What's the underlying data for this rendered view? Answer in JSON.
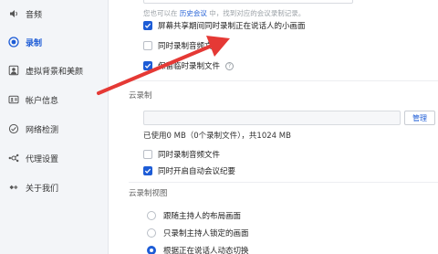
{
  "sidebar": {
    "items": [
      {
        "label": "音频",
        "icon": "speaker-icon",
        "active": false
      },
      {
        "label": "录制",
        "icon": "record-icon",
        "active": true
      },
      {
        "label": "虚拟背景和美颜",
        "icon": "portrait-icon",
        "active": false
      },
      {
        "label": "帐户信息",
        "icon": "account-icon",
        "active": false
      },
      {
        "label": "网络检测",
        "icon": "network-icon",
        "active": false
      },
      {
        "label": "代理设置",
        "icon": "proxy-icon",
        "active": false
      },
      {
        "label": "关于我们",
        "icon": "info-icon",
        "active": false
      }
    ]
  },
  "local_recording": {
    "hint_prefix": "您也可以在",
    "hint_link": "历史会议",
    "hint_suffix": "中，找到对应的会议录制记录。",
    "options": [
      {
        "label": "屏幕共享期间同时录制正在说话人的小画面",
        "checked": true
      },
      {
        "label": "同时录制音频文件",
        "checked": false
      },
      {
        "label": "保留临时录制文件",
        "checked": true,
        "help": "?"
      }
    ]
  },
  "cloud_recording": {
    "title": "云录制",
    "manage_button": "管理",
    "usage": "已使用0 MB（0个录制文件），共1024 MB",
    "options": [
      {
        "label": "同时录制音频文件",
        "checked": false
      },
      {
        "label": "同时开启自动会议纪要",
        "checked": true
      }
    ]
  },
  "cloud_view": {
    "title": "云录制视图",
    "options": [
      {
        "label": "跟随主持人的布局画面",
        "selected": false
      },
      {
        "label": "只录制主持人锁定的画面",
        "selected": false
      },
      {
        "label": "根据正在说话人动态切换",
        "selected": true
      }
    ]
  },
  "colors": {
    "accent": "#1d5cd6",
    "annotation_arrow": "#e53935"
  }
}
